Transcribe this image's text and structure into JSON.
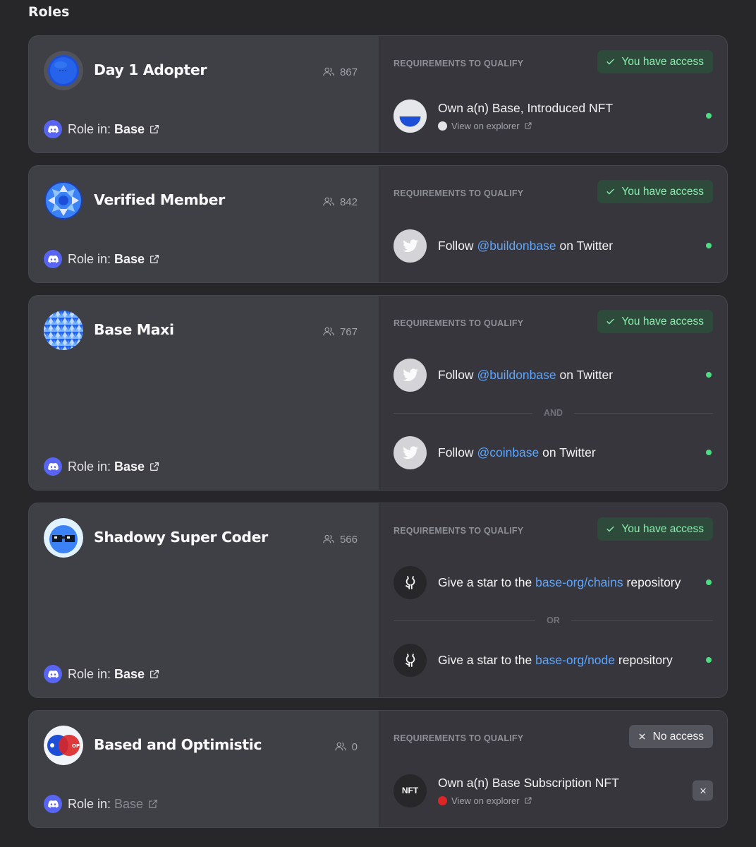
{
  "page": {
    "title": "Roles"
  },
  "colors": {
    "background": "#27272a",
    "card": "#3f3f46",
    "access_green": "#86efac",
    "link_blue": "#60a5fa",
    "discord": "#5865f2"
  },
  "requirements_title": "REQUIREMENTS TO QUALIFY",
  "roles": [
    {
      "name": "Day 1 Adopter",
      "members": "867",
      "icon": "blue-orb-icon",
      "role_in_label": "Role in:",
      "server": "Base",
      "access": "You have access",
      "has_access": true,
      "requirements": [
        {
          "icon": "base-introduced-nft-icon",
          "text_before": "Own a(n) Base, Introduced NFT",
          "explorer": "View on explorer"
        }
      ]
    },
    {
      "name": "Verified Member",
      "members": "842",
      "icon": "verified-badge-icon",
      "role_in_label": "Role in:",
      "server": "Base",
      "access": "You have access",
      "has_access": true,
      "requirements": [
        {
          "icon": "twitter-icon",
          "text_before": "Follow",
          "link": "@buildonbase",
          "text_after": "on Twitter"
        }
      ]
    },
    {
      "name": "Base Maxi",
      "members": "767",
      "icon": "geometric-pattern-icon",
      "role_in_label": "Role in:",
      "server": "Base",
      "access": "You have access",
      "has_access": true,
      "logic": "AND",
      "requirements": [
        {
          "icon": "twitter-icon",
          "text_before": "Follow",
          "link": "@buildonbase",
          "text_after": "on Twitter"
        },
        {
          "icon": "twitter-icon",
          "text_before": "Follow",
          "link": "@coinbase",
          "text_after": "on Twitter"
        }
      ]
    },
    {
      "name": "Shadowy Super Coder",
      "members": "566",
      "icon": "sunglasses-face-icon",
      "role_in_label": "Role in:",
      "server": "Base",
      "access": "You have access",
      "has_access": true,
      "logic": "OR",
      "requirements": [
        {
          "icon": "github-icon",
          "text_before": "Give a star to the",
          "link": "base-org/chains",
          "text_after": "repository"
        },
        {
          "icon": "github-icon",
          "text_before": "Give a star to the",
          "link": "base-org/node",
          "text_after": "repository"
        }
      ]
    },
    {
      "name": "Based and Optimistic",
      "members": "0",
      "icon": "base-op-orbs-icon",
      "role_in_label": "Role in:",
      "server": "Base",
      "access": "No access",
      "has_access": false,
      "requirements": [
        {
          "icon": "nft-icon",
          "icon_text": "NFT",
          "text_before": "Own a(n) Base Subscription NFT",
          "explorer": "View on explorer"
        }
      ]
    }
  ]
}
